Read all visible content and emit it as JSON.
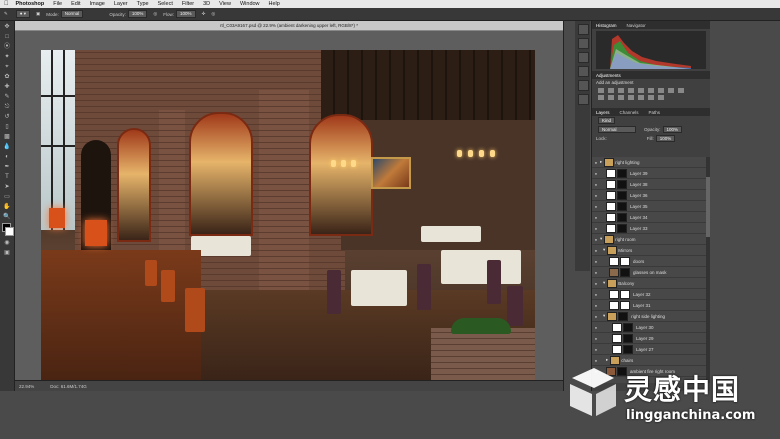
{
  "menubar": {
    "apple": "",
    "app": "Photoshop",
    "items": [
      "File",
      "Edit",
      "Image",
      "Layer",
      "Type",
      "Select",
      "Filter",
      "3D",
      "View",
      "Window",
      "Help"
    ]
  },
  "options": {
    "mode_label": "Mode:",
    "mode_value": "Normal",
    "opacity_label": "Opacity:",
    "opacity_value": "100%",
    "flow_label": "Flow:",
    "flow_value": "100%"
  },
  "document": {
    "title": "rtl_C03A9167.psd @ 22.9% (ambient darkening upper left, RGB/8*) *",
    "zoom": "22.94%",
    "doc_size": "Doc: 61.6M/1.74G"
  },
  "panels": {
    "histogram_tab": "Histogram",
    "navigator_tab": "Navigator",
    "adjustments_tab": "Adjustments",
    "adjustments_title": "Add an adjustment",
    "layers_tab": "Layers",
    "channels_tab": "Channels",
    "paths_tab": "Paths",
    "kind_label": "Kind",
    "blend_mode": "Normal",
    "opacity_label": "Opacity:",
    "opacity_value": "100%",
    "lock_label": "Lock:",
    "fill_label": "Fill:",
    "fill_value": "100%"
  },
  "layers": [
    {
      "name": "right lighting",
      "type": "group"
    },
    {
      "name": "Layer 39",
      "type": "layer"
    },
    {
      "name": "Layer 38",
      "type": "layer"
    },
    {
      "name": "Layer 36",
      "type": "layer"
    },
    {
      "name": "Layer 35",
      "type": "layer"
    },
    {
      "name": "Layer 34",
      "type": "layer"
    },
    {
      "name": "Layer 33",
      "type": "layer"
    },
    {
      "name": "right room",
      "type": "group"
    },
    {
      "name": "Mirrors",
      "type": "group"
    },
    {
      "name": "doors",
      "type": "layer"
    },
    {
      "name": "glasses on mask",
      "type": "layer"
    },
    {
      "name": "Balcony",
      "type": "group"
    },
    {
      "name": "Layer 32",
      "type": "layer"
    },
    {
      "name": "Layer 31",
      "type": "layer"
    },
    {
      "name": "right side lighting",
      "type": "group"
    },
    {
      "name": "Layer 30",
      "type": "layer"
    },
    {
      "name": "Layer 29",
      "type": "layer"
    },
    {
      "name": "Layer 27",
      "type": "layer"
    },
    {
      "name": "chairs",
      "type": "group"
    },
    {
      "name": "ambient fire right room",
      "type": "layer"
    }
  ],
  "statusbar": {
    "zoom": "22.94%",
    "doc": "Doc: 61.6M/1.74G"
  },
  "watermark": {
    "chinese": "灵感中国",
    "url": "lingganchina.com"
  },
  "colors": {
    "ui_dark": "#383838",
    "panel": "#404040",
    "canvas_bg": "#5e5e5e"
  }
}
